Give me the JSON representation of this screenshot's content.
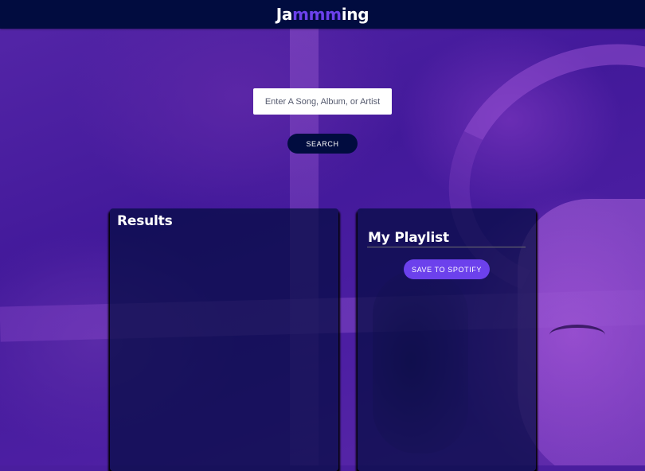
{
  "header": {
    "logo_prefix": "Ja",
    "logo_highlight": "mmm",
    "logo_suffix": "ing"
  },
  "search": {
    "placeholder": "Enter A Song, Album, or Artist",
    "value": "",
    "button_label": "SEARCH"
  },
  "results": {
    "title": "Results",
    "tracks": []
  },
  "playlist": {
    "name": "My Playlist",
    "save_label": "SAVE TO SPOTIFY",
    "tracks": []
  },
  "colors": {
    "header_bg": "#010c3f",
    "accent": "#6c41ec",
    "panel_bg": "rgba(1, 12, 63, 0.7)",
    "text": "#ffffff"
  }
}
